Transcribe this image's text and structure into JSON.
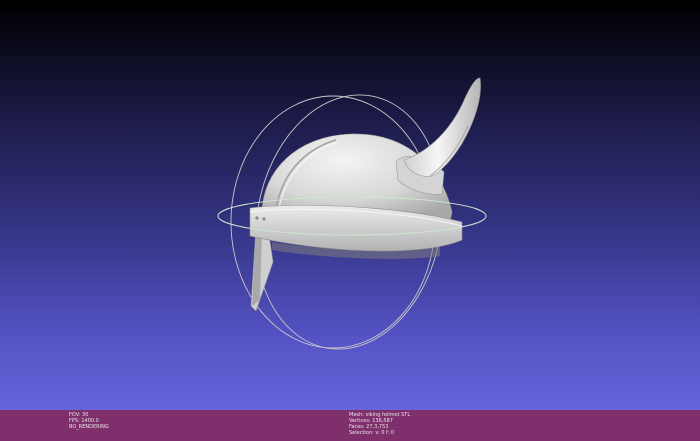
{
  "viewport": {
    "background_top": "#000000",
    "background_bottom": "#6665da",
    "model_color": "#d8d8d8",
    "trackball_color": "#c8c8c8",
    "trackball_equator_color": "#c8e8c8"
  },
  "status_bar": {
    "background": "#7f2f6c",
    "left": {
      "fov": "FOV: 30",
      "fps": "FPS: 1400.0",
      "render_mode": "BO_RENDERING"
    },
    "right": {
      "mesh": "Mesh: viking helmet STL",
      "vertices": "Vertices: 136,587",
      "faces": "Faces: 27,3,753",
      "selection": "Selection: v: 0 f: 0"
    }
  }
}
